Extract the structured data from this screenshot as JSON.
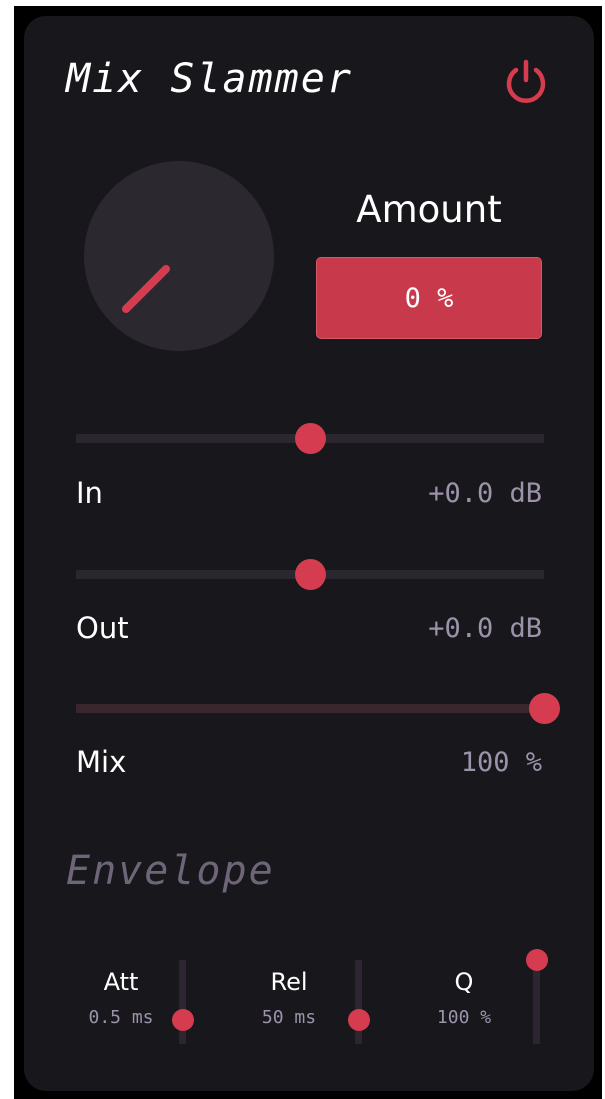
{
  "plugin": {
    "title": "Mix Slammer",
    "power_icon": "power-icon",
    "accent_color": "#d63c4f"
  },
  "amount": {
    "label": "Amount",
    "value": "0 %",
    "knob_level": 0
  },
  "sliders": [
    {
      "key": "in",
      "label": "In",
      "value": "+0.0 dB",
      "level": 0.5
    },
    {
      "key": "out",
      "label": "Out",
      "value": "+0.0 dB",
      "level": 0.5
    },
    {
      "key": "mix",
      "label": "Mix",
      "value": "100 %",
      "level": 1.0
    }
  ],
  "envelope": {
    "heading": "Envelope",
    "controls": [
      {
        "key": "att",
        "label": "Att",
        "value": "0.5 ms",
        "level": 0.28
      },
      {
        "key": "rel",
        "label": "Rel",
        "value": "50 ms",
        "level": 0.28
      },
      {
        "key": "q",
        "label": "Q",
        "value": "100 %",
        "level": 1.0
      }
    ]
  }
}
